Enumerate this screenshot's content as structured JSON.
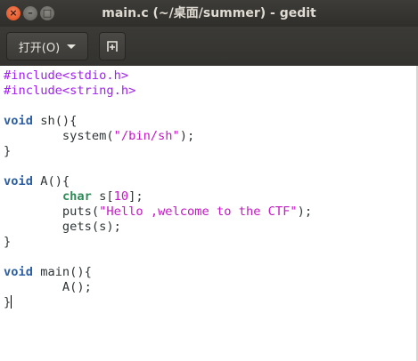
{
  "window": {
    "title": "main.c (~/桌面/summer) - gedit",
    "buttons": {
      "close": "×",
      "minimize": "–",
      "maximize": "□"
    }
  },
  "toolbar": {
    "open_label": "打开(O)",
    "open_icon": "chevron-down-icon",
    "new_icon": "new-document-icon"
  },
  "editor": {
    "lines": [
      [
        {
          "t": "#include<stdio.h>",
          "c": "pp"
        }
      ],
      [
        {
          "t": "#include<string.h>",
          "c": "pp"
        }
      ],
      [],
      [
        {
          "t": "void",
          "c": "kw"
        },
        {
          "t": " sh(){",
          "c": "fn"
        }
      ],
      [
        {
          "t": "        system(",
          "c": "fn"
        },
        {
          "t": "\"/bin/sh\"",
          "c": "str"
        },
        {
          "t": ");",
          "c": "fn"
        }
      ],
      [
        {
          "t": "}",
          "c": "fn"
        }
      ],
      [],
      [
        {
          "t": "void",
          "c": "kw"
        },
        {
          "t": " A(){",
          "c": "fn"
        }
      ],
      [
        {
          "t": "        ",
          "c": "fn"
        },
        {
          "t": "char",
          "c": "ty"
        },
        {
          "t": " s[",
          "c": "fn"
        },
        {
          "t": "10",
          "c": "num"
        },
        {
          "t": "];",
          "c": "fn"
        }
      ],
      [
        {
          "t": "        puts(",
          "c": "fn"
        },
        {
          "t": "\"Hello ,welcome to the CTF\"",
          "c": "str"
        },
        {
          "t": ");",
          "c": "fn"
        }
      ],
      [
        {
          "t": "        gets(s);",
          "c": "fn"
        }
      ],
      [
        {
          "t": "}",
          "c": "fn"
        }
      ],
      [],
      [
        {
          "t": "void",
          "c": "kw"
        },
        {
          "t": " main(){",
          "c": "fn"
        }
      ],
      [
        {
          "t": "        A();",
          "c": "fn"
        }
      ],
      [
        {
          "t": "}",
          "c": "fn"
        }
      ]
    ],
    "cursor_line": 15
  },
  "colors": {
    "preprocessor": "#a020f0",
    "keyword": "#2e5fa3",
    "type": "#2e8b57",
    "string": "#c318c3"
  }
}
